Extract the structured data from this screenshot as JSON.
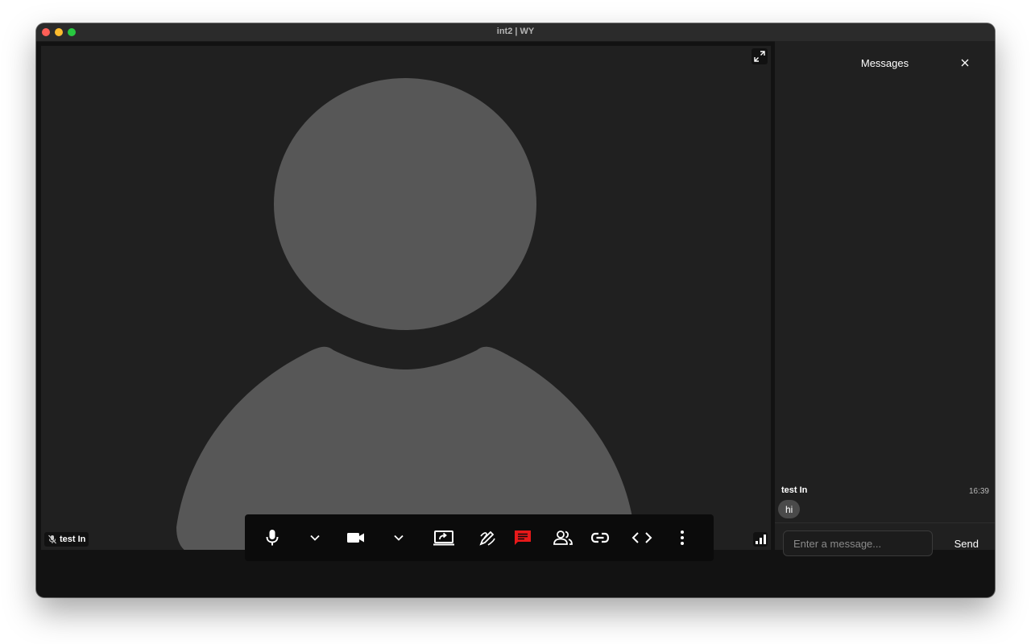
{
  "window": {
    "title": "int2 | WY"
  },
  "video": {
    "participant_name": "test In",
    "mic_muted": true
  },
  "chat": {
    "title": "Messages",
    "messages": [
      {
        "sender": "test In",
        "time": "16:39",
        "text": "hi"
      }
    ],
    "input_placeholder": "Enter a message...",
    "send_label": "Send"
  },
  "toolbar": {
    "buttons": [
      {
        "name": "microphone-button",
        "icon": "microphone-icon"
      },
      {
        "name": "audio-options-button",
        "icon": "chevron-down-icon"
      },
      {
        "name": "camera-button",
        "icon": "video-camera-icon"
      },
      {
        "name": "video-options-button",
        "icon": "chevron-down-icon"
      },
      {
        "name": "screen-share-button",
        "icon": "screen-share-icon"
      },
      {
        "name": "whiteboard-button",
        "icon": "draw-icon"
      },
      {
        "name": "chat-button",
        "icon": "chat-icon",
        "active": true
      },
      {
        "name": "participants-button",
        "icon": "people-icon"
      },
      {
        "name": "copy-link-button",
        "icon": "link-icon"
      },
      {
        "name": "embed-code-button",
        "icon": "code-icon"
      },
      {
        "name": "more-options-button",
        "icon": "more-vertical-icon"
      }
    ]
  },
  "colors": {
    "chat_active": "#e8191a",
    "avatar": "#575757",
    "video_bg": "#202020",
    "toolbar_bg": "#0b0b0b"
  }
}
